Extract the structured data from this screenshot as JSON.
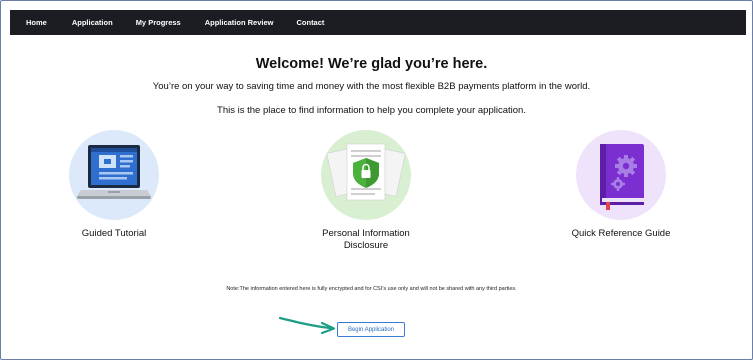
{
  "nav": {
    "items": [
      "Home",
      "Application",
      "My Progress",
      "Application Review",
      "Contact"
    ]
  },
  "main": {
    "welcome": "Welcome! We’re glad you’re here.",
    "subtitle": "You’re on your way to saving time and money with the most flexible B2B payments platform in the world.",
    "subtitle2": "This is the place to find information to help you complete your application."
  },
  "cards": [
    {
      "label": "Guided Tutorial",
      "icon": "laptop-icon"
    },
    {
      "label": "Personal Information Disclosure",
      "icon": "shield-documents-icon"
    },
    {
      "label": "Quick Reference Guide",
      "icon": "book-gears-icon"
    }
  ],
  "note": "Note:The information entered here is fully encrypted and for CSI’s use only and will not be shared with any third parties.",
  "button": {
    "label": "Begin Application"
  },
  "colors": {
    "navbar": "#1b1d22",
    "accent": "#3a7bd5",
    "arrow": "#1e9e86",
    "blue_circle": "#dbe9fb",
    "green_circle": "#d8efd2",
    "purple_circle": "#efe3fb"
  }
}
